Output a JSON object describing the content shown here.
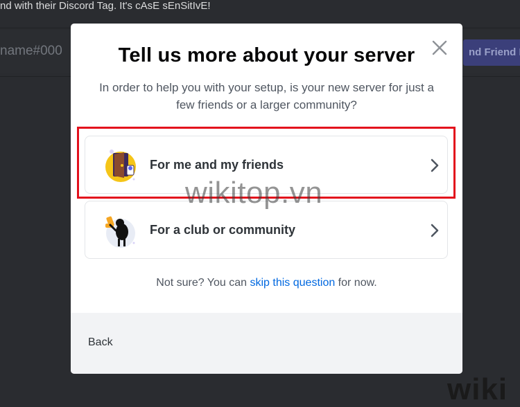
{
  "background": {
    "top_text": "nd with their Discord Tag. It's cAsE sEnSitIvE!",
    "input_placeholder": "name#000",
    "add_button_label": "nd Friend R",
    "corner_watermark": "wiki"
  },
  "modal": {
    "title": "Tell us more about your server",
    "subtitle": "In order to help you with your setup, is your new server for just a few friends or a larger community?",
    "options": [
      {
        "label": "For me and my friends",
        "icon": "friends-door-illustration"
      },
      {
        "label": "For a club or community",
        "icon": "club-mascot-illustration"
      }
    ],
    "hint_prefix": "Not sure? You can ",
    "hint_link": "skip this question",
    "hint_suffix": " for now.",
    "back_label": "Back",
    "close_icon": "close-icon"
  },
  "overlay_watermark": "wikitop.vn",
  "colors": {
    "highlight": "#e3101c",
    "link": "#0068e0",
    "footer_bg": "#f2f3f5"
  }
}
